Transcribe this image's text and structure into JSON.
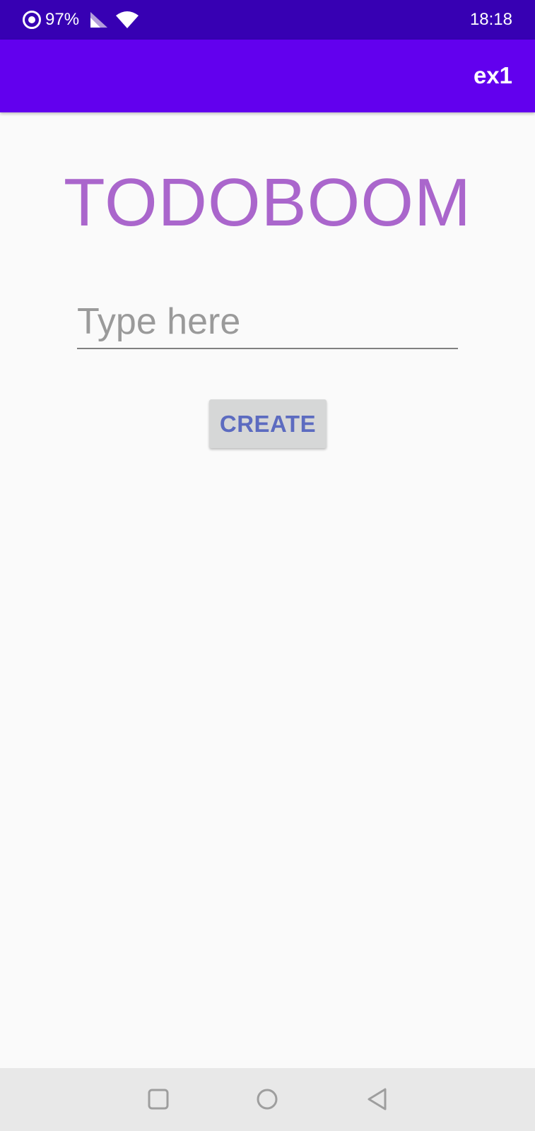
{
  "status_bar": {
    "battery": "97%",
    "time": "18:18",
    "icons": [
      "ring-icon",
      "signal-icon",
      "wifi-icon"
    ]
  },
  "app_bar": {
    "title": "ex1",
    "color": "#6200ee"
  },
  "main": {
    "heading": "TODOBOOM",
    "heading_color": "#aa66cc",
    "input": {
      "value": "",
      "placeholder": "Type here"
    },
    "create_button": {
      "label": "CREATE"
    }
  },
  "nav_bar": {
    "icons": [
      "recents-icon",
      "home-icon",
      "back-icon"
    ]
  }
}
